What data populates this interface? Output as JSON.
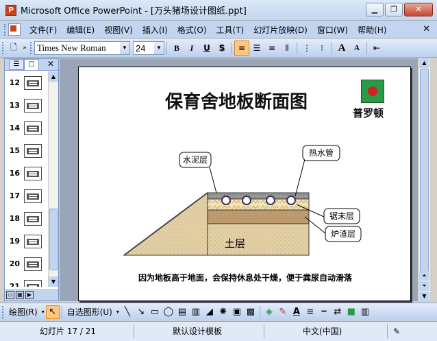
{
  "window": {
    "title": "Microsoft Office PowerPoint - [万头猪场设计图纸.ppt]",
    "app_icon": "P"
  },
  "menubar": {
    "items": [
      "文件(F)",
      "编辑(E)",
      "视图(V)",
      "插入(I)",
      "格式(O)",
      "工具(T)",
      "幻灯片放映(D)",
      "窗口(W)",
      "帮助(H)"
    ]
  },
  "toolbar": {
    "font_name": "Times New Roman",
    "font_size": "24",
    "bold": "B",
    "italic": "I",
    "underline": "U",
    "shadow": "S",
    "grow_font": "A",
    "shrink_font": "A"
  },
  "slides_pane": {
    "slide_numbers": [
      "12",
      "13",
      "14",
      "15",
      "16",
      "17",
      "18",
      "19",
      "20",
      "21"
    ]
  },
  "slide": {
    "title": "保育舍地板断面图",
    "logo_text": "普罗顿",
    "labels": {
      "cement": "水泥层",
      "hot_pipe": "热水管",
      "sawdust": "锯末层",
      "slag": "炉渣层",
      "soil": "土层"
    },
    "caption": "因为地板高于地面，会保持休息处干燥，便于粪尿自动滑落"
  },
  "drawbar": {
    "draw_label": "绘图(R)",
    "autoshapes_label": "自选图形(U)"
  },
  "statusbar": {
    "slide_info": "幻灯片 17 / 21",
    "template": "默认设计模板",
    "language": "中文(中国)"
  },
  "colors": {
    "titlebar": "#c3d7ef",
    "menubar": "#c2d5f0",
    "toolbar_active": "#ffc680",
    "workspace": "#9aa6b8",
    "logo_green": "#2a9a48",
    "logo_red": "#d8201f"
  }
}
